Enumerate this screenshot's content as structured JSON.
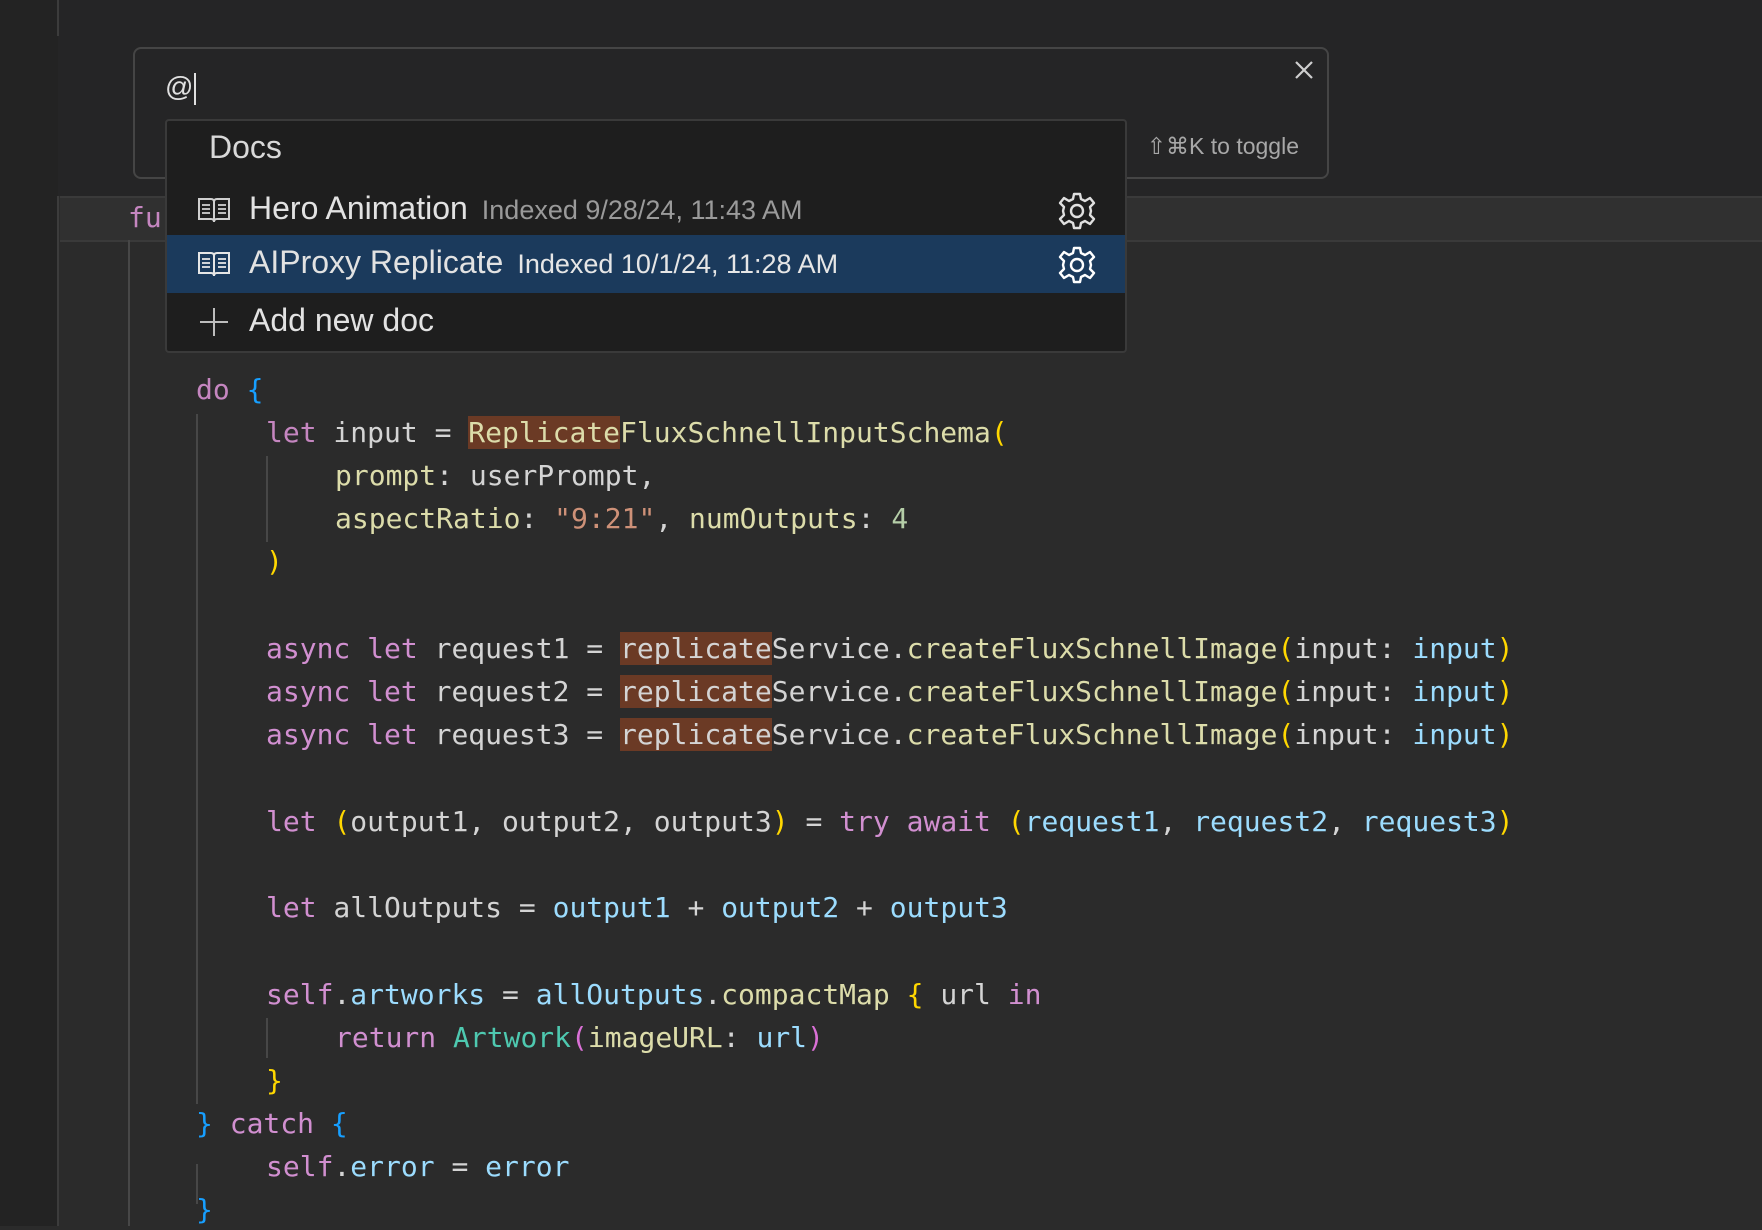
{
  "search": {
    "value": "@",
    "toggle_hint": "⇧⌘K to toggle"
  },
  "dropdown": {
    "header": "Docs",
    "items": [
      {
        "label": "Hero Animation",
        "meta": "Indexed 9/28/24, 11:43 AM",
        "icon": "book-icon",
        "selected": false
      },
      {
        "label": "AIProxy Replicate",
        "meta": "Indexed 10/1/24, 11:28 AM",
        "icon": "book-icon",
        "selected": true
      }
    ],
    "add_label": "Add new doc"
  },
  "code": {
    "partial_keyword": "fu",
    "lines": [
      "do {",
      "let input = ReplicateFluxSchnellInputSchema(",
      "prompt: userPrompt,",
      "aspectRatio: \"9:21\", numOutputs: 4",
      ")",
      "async let request1 = replicateService.createFluxSchnellImage(input: input)",
      "async let request2 = replicateService.createFluxSchnellImage(input: input)",
      "async let request3 = replicateService.createFluxSchnellImage(input: input)",
      "let (output1, output2, output3) = try await (request1, request2, request3)",
      "let allOutputs = output1 + output2 + output3",
      "self.artworks = allOutputs.compactMap { url in",
      "return Artwork(imageURL: url)",
      "}",
      "} catch {",
      "self.error = error",
      "}"
    ]
  },
  "colors": {
    "background": "#2b2b2b",
    "selected_row": "#1b3a5c",
    "match_highlight": "#6b3a25"
  }
}
